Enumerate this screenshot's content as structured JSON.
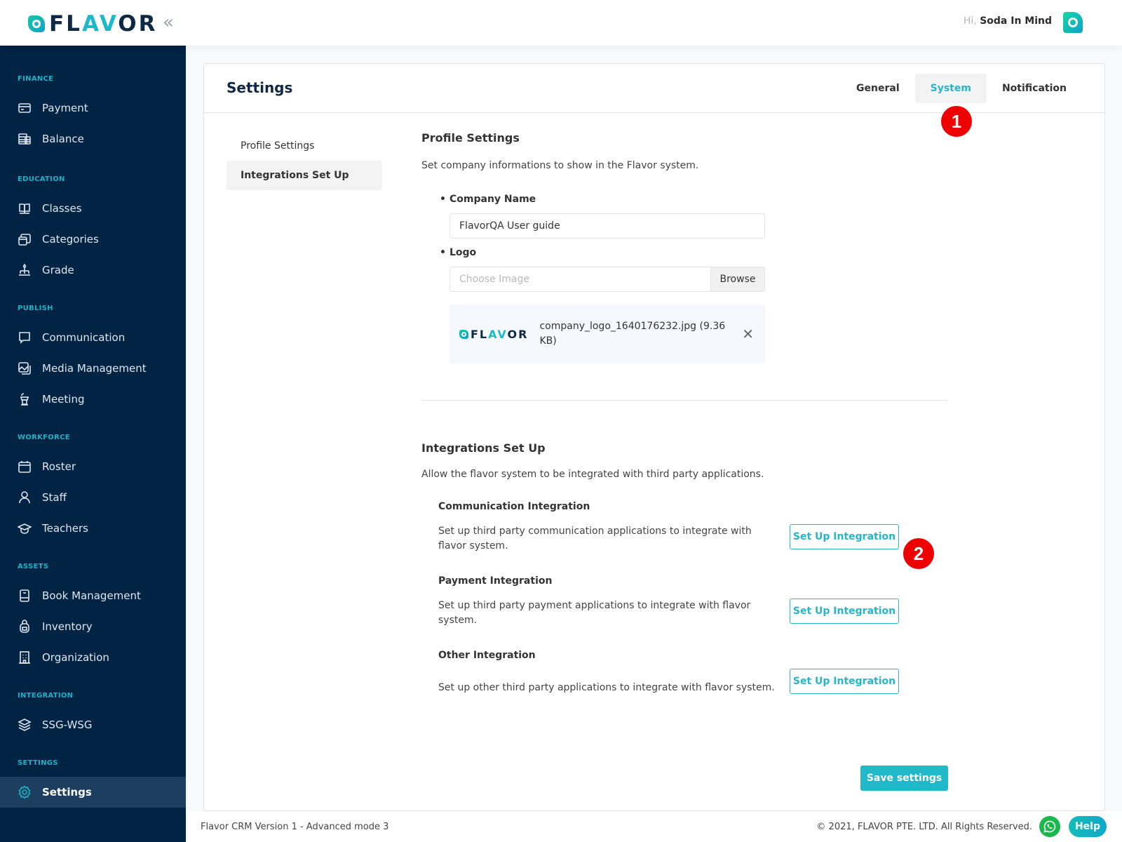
{
  "header": {
    "brand": "FLAVOR",
    "brand_parts": [
      "FL",
      "A",
      "V",
      "OR"
    ],
    "collapse_icon": "«",
    "greeting": "Hi,",
    "user_name": "Soda In Mind"
  },
  "sidebar": {
    "sections": [
      {
        "label": "FINANCE",
        "items": [
          {
            "label": "Payment",
            "icon": "credit-card-icon"
          },
          {
            "label": "Balance",
            "icon": "ledger-icon"
          }
        ]
      },
      {
        "label": "EDUCATION",
        "items": [
          {
            "label": "Classes",
            "icon": "open-book-icon"
          },
          {
            "label": "Categories",
            "icon": "stacked-cards-icon"
          },
          {
            "label": "Grade",
            "icon": "hierarchy-icon"
          }
        ]
      },
      {
        "label": "PUBLISH",
        "items": [
          {
            "label": "Communication",
            "icon": "chat-icon"
          },
          {
            "label": "Media Management",
            "icon": "image-gallery-icon"
          },
          {
            "label": "Meeting",
            "icon": "podium-icon"
          }
        ]
      },
      {
        "label": "WORKFORCE",
        "items": [
          {
            "label": "Roster",
            "icon": "calendar-icon"
          },
          {
            "label": "Staff",
            "icon": "user-icon"
          },
          {
            "label": "Teachers",
            "icon": "graduation-cap-icon"
          }
        ]
      },
      {
        "label": "ASSETS",
        "items": [
          {
            "label": "Book Management",
            "icon": "book-icon"
          },
          {
            "label": "Inventory",
            "icon": "backpack-icon"
          },
          {
            "label": "Organization",
            "icon": "building-icon"
          }
        ]
      },
      {
        "label": "INTEGRATION",
        "items": [
          {
            "label": "SSG-WSG",
            "icon": "layers-icon"
          }
        ]
      },
      {
        "label": "SETTINGS",
        "items": [
          {
            "label": "Settings",
            "icon": "gear-icon",
            "active": true
          }
        ]
      }
    ]
  },
  "page": {
    "title": "Settings",
    "tabs": [
      {
        "label": "General"
      },
      {
        "label": "System",
        "active": true
      },
      {
        "label": "Notification"
      }
    ],
    "subnav": [
      {
        "label": "Profile Settings"
      },
      {
        "label": "Integrations Set Up",
        "active": true
      }
    ]
  },
  "profile": {
    "title": "Profile Settings",
    "description": "Set company informations to show in the Flavor system.",
    "company_name_label": "Company Name",
    "company_name_value": "FlavorQA User guide",
    "logo_label": "Logo",
    "logo_placeholder": "Choose Image",
    "browse_label": "Browse",
    "file_name": "company_logo_1640176232.jpg (9.36 KB)"
  },
  "integrations": {
    "title": "Integrations Set Up",
    "description": "Allow the flavor system to be integrated with third party applications.",
    "items": [
      {
        "title": "Communication Integration",
        "description": "Set up third party communication applications to integrate with flavor system.",
        "button": "Set Up Integration"
      },
      {
        "title": "Payment Integration",
        "description": "Set up third party payment applications to integrate with flavor system.",
        "button": "Set Up Integration"
      },
      {
        "title": "Other Integration",
        "description": "Set up other third party applications to integrate with flavor system.",
        "button": "Set Up Integration"
      }
    ],
    "save_label": "Save settings"
  },
  "annotations": [
    {
      "number": "1",
      "target": "System tab"
    },
    {
      "number": "2",
      "target": "Communication Integration set up button"
    }
  ],
  "footer": {
    "version": "Flavor CRM Version 1 - Advanced mode 3",
    "copyright": "© 2021, FLAVOR PTE. LTD. All Rights Reserved.",
    "help_label": "Help"
  },
  "colors": {
    "accent": "#21b8c9",
    "sidebar_bg": "#012344",
    "sidebar_active": "#1c3e5f",
    "badge": "#ee0000",
    "whatsapp": "#1ab84c"
  }
}
